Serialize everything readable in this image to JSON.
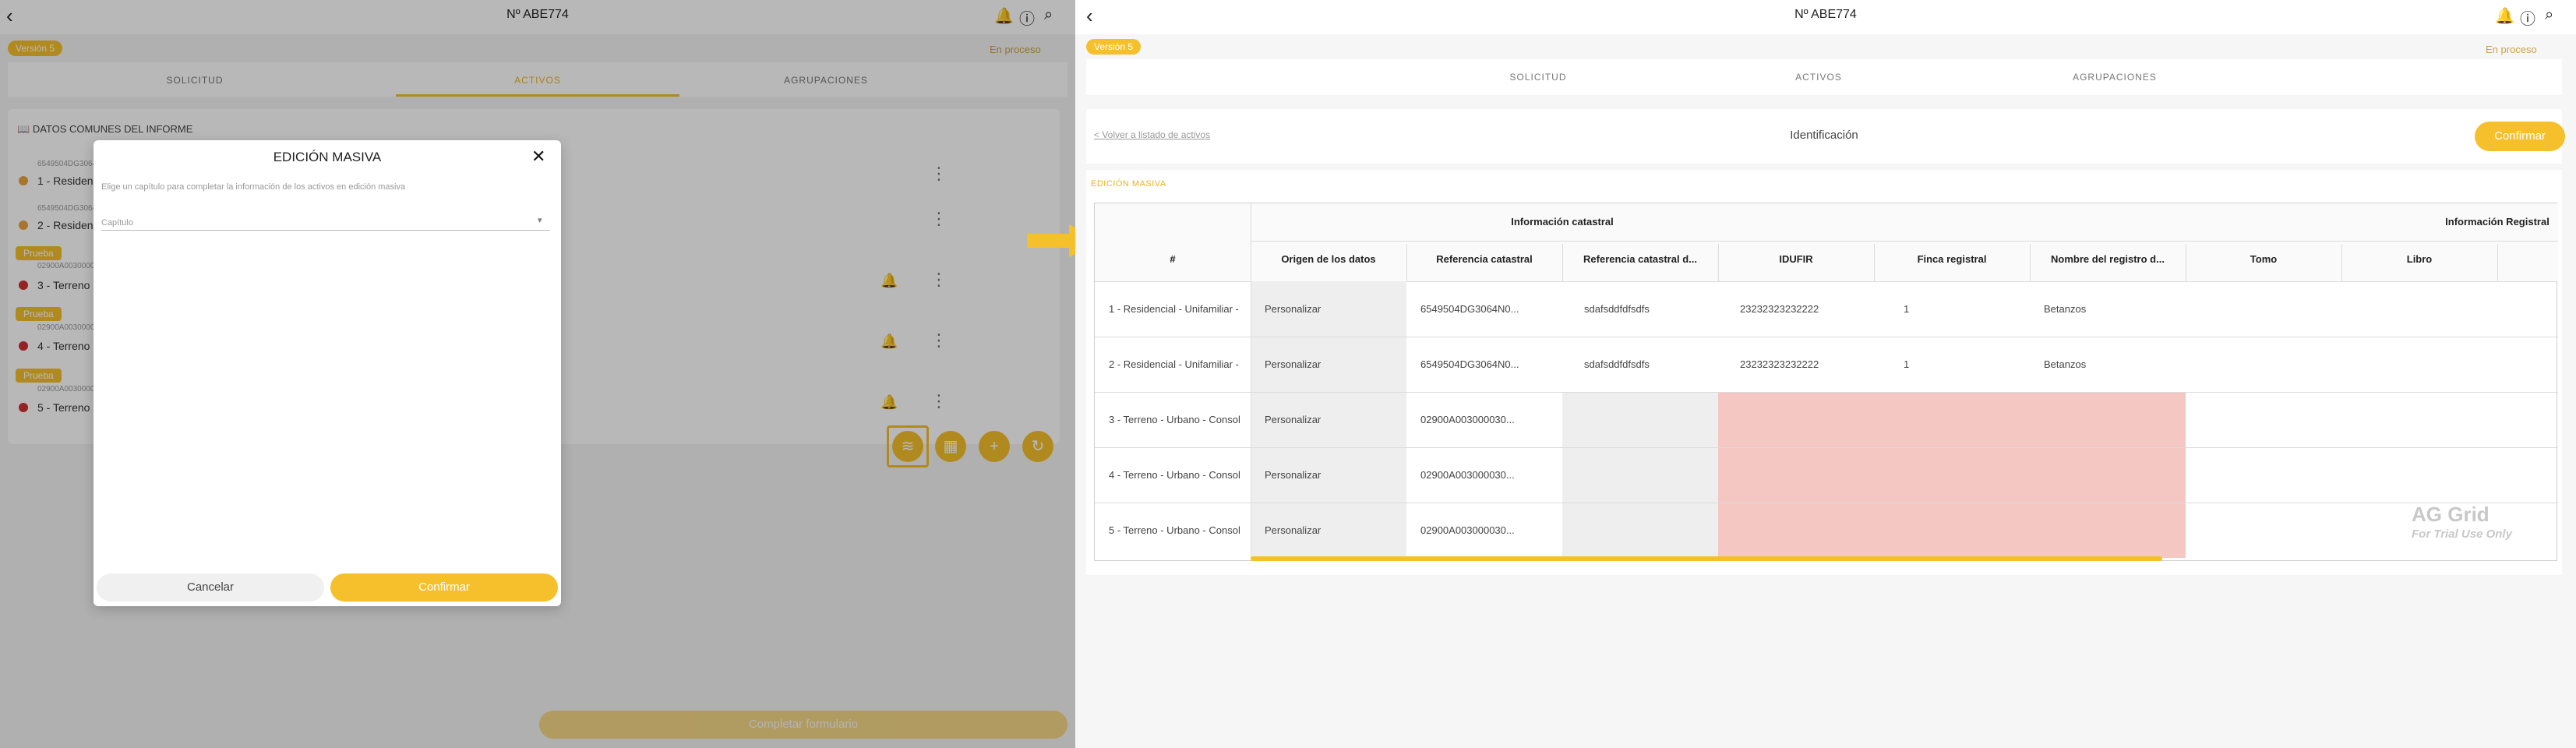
{
  "left": {
    "header": {
      "title": "Nº ABE774",
      "version_badge": "Versión 5",
      "status": "En proceso"
    },
    "tabs": [
      {
        "label": "SOLICITUD"
      },
      {
        "label": "ACTIVOS"
      },
      {
        "label": "AGRUPACIONES"
      }
    ],
    "section_title": "DATOS COMUNES DEL INFORME",
    "items": [
      {
        "ref": "6549504DG3064N0",
        "label": "1 - Residencial",
        "pill": ""
      },
      {
        "ref": "6549504DG3064N0",
        "label": "2 - Residencial",
        "pill": ""
      },
      {
        "ref": "02900A00300003",
        "label": "3 - Terreno",
        "pill": "Prueba"
      },
      {
        "ref": "02900A00300003",
        "label": "4 - Terreno",
        "pill": "Prueba"
      },
      {
        "ref": "02900A00300003",
        "label": "5 - Terreno",
        "pill": "Prueba"
      }
    ],
    "bottom_button": "Completar formulario",
    "modal": {
      "title": "EDICIÓN MASIVA",
      "description": "Elige un capítulo para completar la información de los activos en edición masiva",
      "select_placeholder": "Capítulo",
      "cancel": "Cancelar",
      "confirm": "Confirmar"
    },
    "colors": {
      "accent": "#f5c02b",
      "orange_dot": "#e9a23b",
      "red_dot": "#d03030"
    }
  },
  "right": {
    "header": {
      "title": "Nº ABE774",
      "version_badge": "Versión 5",
      "status": "En proceso"
    },
    "tabs": [
      {
        "label": "SOLICITUD"
      },
      {
        "label": "ACTIVOS"
      },
      {
        "label": "AGRUPACIONES"
      }
    ],
    "back_link": "< Volver a listado de activos",
    "section_label": "Identificación",
    "confirm_button": "Confirmar",
    "edition_label": "EDICIÓN MASIVA",
    "grid": {
      "group_headers": [
        "Información catastral",
        "Información Registral"
      ],
      "columns": [
        "#",
        "Origen de los datos",
        "Referencia catastral",
        "Referencia catastral d...",
        "IDUFIR",
        "Finca registral",
        "Nombre del registro d...",
        "Tomo",
        "Libro"
      ],
      "rows": [
        {
          "id": "1 - Residencial - Unifamiliar -",
          "origen": "Personalizar",
          "ref": "6549504DG3064N0...",
          "ref2": "sdafsddfdfsdfs",
          "idufir": "23232323232222",
          "finca": "1",
          "registro": "Betanzos",
          "tomo": "",
          "libro": ""
        },
        {
          "id": "2 - Residencial - Unifamiliar -",
          "origen": "Personalizar",
          "ref": "6549504DG3064N0...",
          "ref2": "sdafsddfdfsdfs",
          "idufir": "23232323232222",
          "finca": "1",
          "registro": "Betanzos",
          "tomo": "",
          "libro": ""
        },
        {
          "id": "3 - Terreno - Urbano - Consol",
          "origen": "Personalizar",
          "ref": "02900A003000030...",
          "ref2": "",
          "idufir": "",
          "finca": "",
          "registro": "",
          "tomo": "",
          "libro": ""
        },
        {
          "id": "4 - Terreno - Urbano - Consol",
          "origen": "Personalizar",
          "ref": "02900A003000030...",
          "ref2": "",
          "idufir": "",
          "finca": "",
          "registro": "",
          "tomo": "",
          "libro": ""
        },
        {
          "id": "5 - Terreno - Urbano - Consol",
          "origen": "Personalizar",
          "ref": "02900A003000030...",
          "ref2": "",
          "idufir": "",
          "finca": "",
          "registro": "",
          "tomo": "",
          "libro": ""
        }
      ],
      "watermark": "AG Grid",
      "watermark_sub": "For Trial Use Only"
    },
    "colors": {
      "error_fill": "#f4c7c3",
      "readonly_fill": "#eeeeee"
    }
  }
}
